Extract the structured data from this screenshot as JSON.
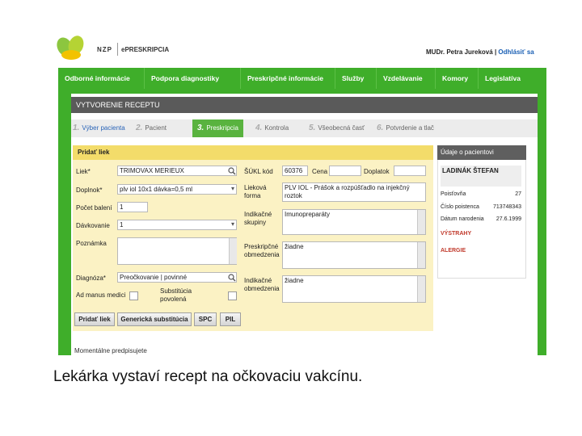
{
  "header": {
    "brand": "NZP",
    "brand2": "ePRESKRIPCIA",
    "user": "MUDr. Petra Jureková",
    "separator": "|",
    "logout": "Odhlásiť sa",
    "colors": {
      "green": "#3fae2a",
      "yellow": "#f3dc6a"
    }
  },
  "nav": [
    "Odborné informácie",
    "Podpora diagnostiky",
    "Preskripčné informácie",
    "Služby",
    "Vzdelávanie",
    "Komory",
    "Legislatíva"
  ],
  "page_title": "VYTVORENIE RECEPTU",
  "steps": [
    {
      "num": "1.",
      "label": "Výber pacienta"
    },
    {
      "num": "2.",
      "label": "Pacient"
    },
    {
      "num": "3.",
      "label": "Preskripcia"
    },
    {
      "num": "4.",
      "label": "Kontrola"
    },
    {
      "num": "5.",
      "label": "Všeobecná časť"
    },
    {
      "num": "6.",
      "label": "Potvrdenie a tlač"
    }
  ],
  "form": {
    "header": "Pridať liek",
    "liek_label": "Liek*",
    "liek_value": "TRIMOVAX MERIEUX",
    "sukl_label": "ŠÚKL kód",
    "sukl_value": "60376",
    "cena_label": "Cena",
    "doplatok_label": "Doplatok",
    "doplnok_label": "Doplnok*",
    "doplnok_value": "plv iol 10x1 dávka=0,5 ml",
    "liekova_forma_label": "Lieková forma",
    "liekova_forma_value": "PLV IOL - Prášok a rozpúšťadlo na injekčný roztok",
    "pocet_label": "Počet balení",
    "pocet_value": "1",
    "davkovanie_label": "Dávkovanie",
    "davkovanie_value": "1",
    "indikacne_label": "Indikačné skupiny",
    "indikacne_value": "Imunopreparáty",
    "poznamka_label": "Poznámka",
    "preskripcne_label": "Preskripčné obmedzenia",
    "preskripcne_value": "žiadne",
    "diagnoza_label": "Diagnóza*",
    "diagnoza_value": "Preočkovanie | povinné",
    "indikacne_obm_label": "Indikačné obmedzenia",
    "indikacne_obm_value": "žiadne",
    "ad_manus_label": "Ad manus medici",
    "substitucia_label": "Substitúcia povolená"
  },
  "buttons": [
    "Pridať liek",
    "Generická substitúcia",
    "SPC",
    "PIL"
  ],
  "patient": {
    "header": "Údaje o pacientovi",
    "name": "LADINÁK ŠTEFAN",
    "rows": [
      {
        "label": "Poisťovňa",
        "value": "27"
      },
      {
        "label": "Číslo poistenca",
        "value": "713748343"
      },
      {
        "label": "Dátum narodenia",
        "value": "27.6.1999"
      }
    ],
    "links": [
      "VÝSTRAHY",
      "ALERGIE"
    ]
  },
  "bottom_text": "Momentálne predpisujete",
  "caption": "Lekárka vystaví recept na očkovaciu vakcínu."
}
